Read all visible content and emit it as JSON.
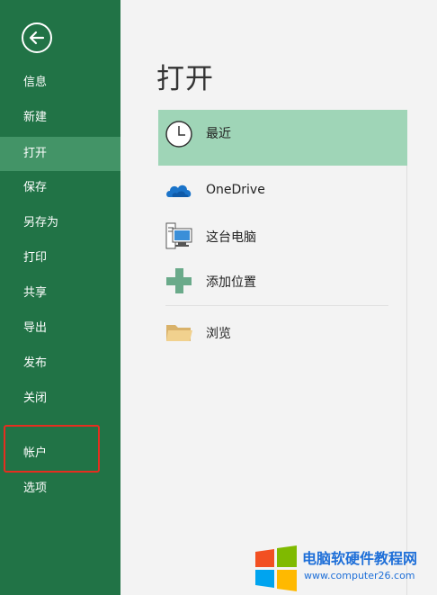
{
  "sidebar": {
    "items": [
      {
        "label": "信息"
      },
      {
        "label": "新建"
      },
      {
        "label": "打开"
      },
      {
        "label": "保存"
      },
      {
        "label": "另存为"
      },
      {
        "label": "打印"
      },
      {
        "label": "共享"
      },
      {
        "label": "导出"
      },
      {
        "label": "发布"
      },
      {
        "label": "关闭"
      },
      {
        "label": "帐户"
      },
      {
        "label": "选项"
      }
    ],
    "active_item": "打开",
    "highlighted_item": "帐户"
  },
  "main": {
    "title": "打开",
    "locations": [
      {
        "label": "最近",
        "icon": "clock-icon",
        "selected": true
      },
      {
        "label": "OneDrive",
        "icon": "cloud-icon"
      },
      {
        "label": "这台电脑",
        "icon": "computer-icon"
      },
      {
        "label": "添加位置",
        "icon": "plus-icon"
      },
      {
        "label": "浏览",
        "icon": "folder-icon"
      }
    ]
  },
  "watermark": {
    "title": "电脑软硬件教程网",
    "url": "www.computer26.com"
  },
  "colors": {
    "sidebar": "#217346",
    "sidebar_active": "#439467",
    "selected_location": "#9fd5b7",
    "highlight_border": "#e52e1f"
  }
}
